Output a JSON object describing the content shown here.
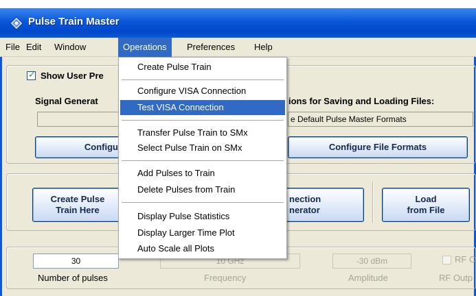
{
  "window": {
    "title": "Pulse Train Master"
  },
  "menubar": {
    "items": [
      "File",
      "Edit",
      "Window",
      "Operations",
      "Preferences",
      "Help"
    ]
  },
  "operations_menu": {
    "group1": [
      "Create Pulse Train"
    ],
    "group2": [
      "Configure VISA Connection",
      "Test VISA Connection"
    ],
    "group3": [
      "Transfer Pulse Train to SMx",
      "Select Pulse Train on SMx"
    ],
    "group4": [
      "Add Pulses to Train",
      "Delete Pulses from Train"
    ],
    "group5": [
      "Display Pulse Statistics",
      "Display Larger Time Plot",
      "Auto Scale all Plots"
    ],
    "highlighted": "Test VISA Connection"
  },
  "top_panel": {
    "show_user_prefs_label": "Show User Pre",
    "signal_generator_label": "Signal Generat",
    "options_label": "ions for Saving and Loading Files:",
    "file_format_value": "e Default Pulse Master Formats",
    "configure_button": "Configu",
    "configure_file_formats_button": "Configure File Formats"
  },
  "middle_panel": {
    "create_pulse_train_button": [
      "Create Pulse",
      "Train Here"
    ],
    "connection_button": [
      "nection",
      "nerator"
    ],
    "load_button": [
      "Load",
      "from File"
    ]
  },
  "bottom_panel": {
    "num_pulses_value": "30",
    "num_pulses_label": "Number of pulses",
    "frequency_value": "10 GHz",
    "frequency_label": "Frequency",
    "amplitude_value": "-30 dBm",
    "amplitude_label": "Amplitude",
    "rf_checkbox_label": "RF C",
    "rf_output_label": "RF Outp"
  },
  "colors": {
    "titlebar": "#0a57d8",
    "highlight": "#316ac5",
    "dialog_bg": "#ece9d8"
  }
}
